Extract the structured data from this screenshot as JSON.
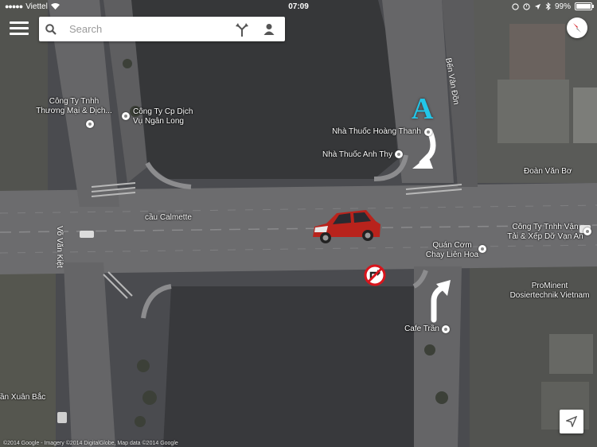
{
  "status_bar": {
    "signal": "●●●●●",
    "carrier": "Viettel",
    "time": "07:09",
    "battery": "99%"
  },
  "search": {
    "placeholder": "Search",
    "value": ""
  },
  "marker": {
    "label": "A",
    "color": "#22c6e8"
  },
  "places": {
    "cong_ty_thuong_mai": "Công Ty Tnhh\nThương Mại & Dịch...",
    "cong_ty_cp_dich_vu": "Công Ty Cp Dịch\nVụ Ngân Long",
    "nha_thuoc_hoang_thanh": "Nhà Thuốc Hoàng Thanh",
    "nha_thuoc_anh_thy": "Nhà Thuốc Anh Thy",
    "doan_van_bo": "Đoàn Văn Bơ",
    "cau_calmette": "cầu Calmette",
    "vo_van_kiet": "Võ Văn Kiệt",
    "ben_van_don": "Bến Vân Đồn",
    "cong_ty_van_tai": "Công Ty Tnhh Vận\nTải & Xếp Dỡ Vạn An",
    "quan_com_chay": "Quán Cơm\nChay Liên Hoa",
    "prominent": "ProMinent\nDosiertechnik Vietnam",
    "cafe_tran": "Cafe Trần",
    "an_xuan_bac": "ần Xuân Bắc"
  },
  "attribution": "©2014 Google - Imagery ©2014 DigitalGlobe, Map data ©2014 Google",
  "icons": {
    "menu": "menu-icon",
    "search": "search-icon",
    "directions": "directions-icon",
    "account": "person-icon",
    "compass": "compass-icon",
    "locate": "my-location-icon",
    "no_right_turn": "no-right-turn-sign-icon",
    "car": "car-icon"
  },
  "colors": {
    "water": "#34343a",
    "road": "#6e6e70",
    "marker": "#22c6e8",
    "sign_red": "#d8141c",
    "car_red": "#b8231c"
  }
}
